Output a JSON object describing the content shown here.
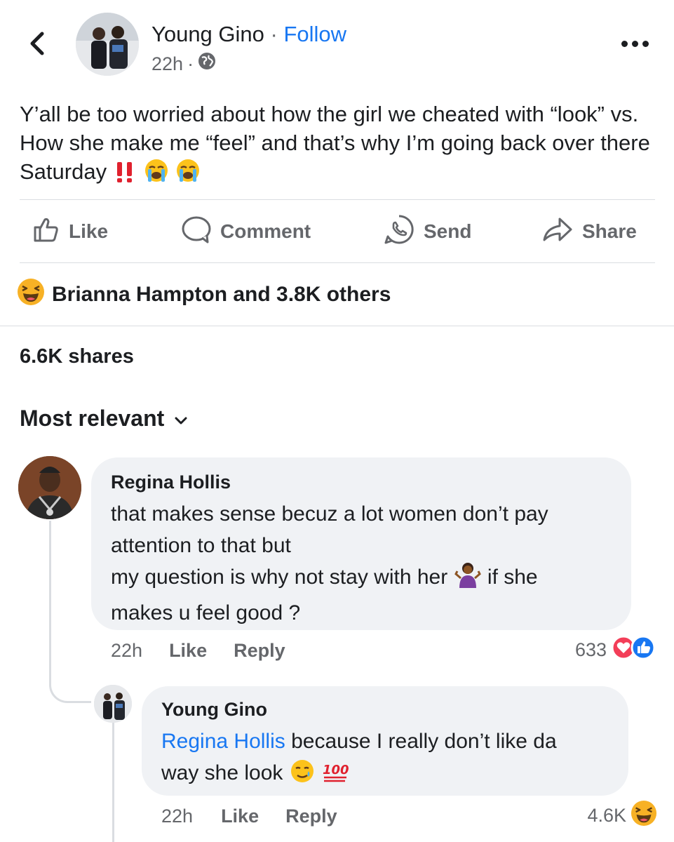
{
  "post": {
    "author": "Young Gino",
    "separator": "·",
    "follow_label": "Follow",
    "time": "22h",
    "meta_dot": "·",
    "text": "Y’all be too worried about how the girl we cheated with “look” vs. How she make me “feel” and that’s why I’m going back over there Saturday",
    "text_emojis": "‼️ 😭 😭"
  },
  "actions": {
    "like": "Like",
    "comment": "Comment",
    "send": "Send",
    "share": "Share"
  },
  "reactions": {
    "emoji": "😆",
    "summary": "Brianna Hampton and 3.8K others"
  },
  "shares": "6.6K shares",
  "sort": {
    "label": "Most relevant"
  },
  "comments": [
    {
      "name": "Regina Hollis",
      "lines": [
        "that makes sense becuz a lot women don’t pay",
        "attention to that but",
        "my question is why not stay with her",
        "if she",
        "makes u feel good ?"
      ],
      "emoji": "🤷🏾‍♀️",
      "time": "22h",
      "like_label": "Like",
      "reply_label": "Reply",
      "reaction_count": "633",
      "reaction_icons": [
        "love-reaction",
        "like-reaction"
      ]
    },
    {
      "name": "Young Gino",
      "mention": "Regina Hollis",
      "text_1": "because I really don’t like da",
      "text_2": "way she look",
      "emoji": "🥲 💯",
      "time": "22h",
      "like_label": "Like",
      "reply_label": "Reply",
      "reaction_count": "4.6K",
      "reaction_icons": [
        "haha-reaction"
      ]
    }
  ],
  "colors": {
    "link_blue": "#1877f2",
    "secondary_text": "#65676b",
    "bubble_bg": "#f0f2f5",
    "love_red": "#f33e58",
    "haha_yellow": "#f7b125"
  }
}
